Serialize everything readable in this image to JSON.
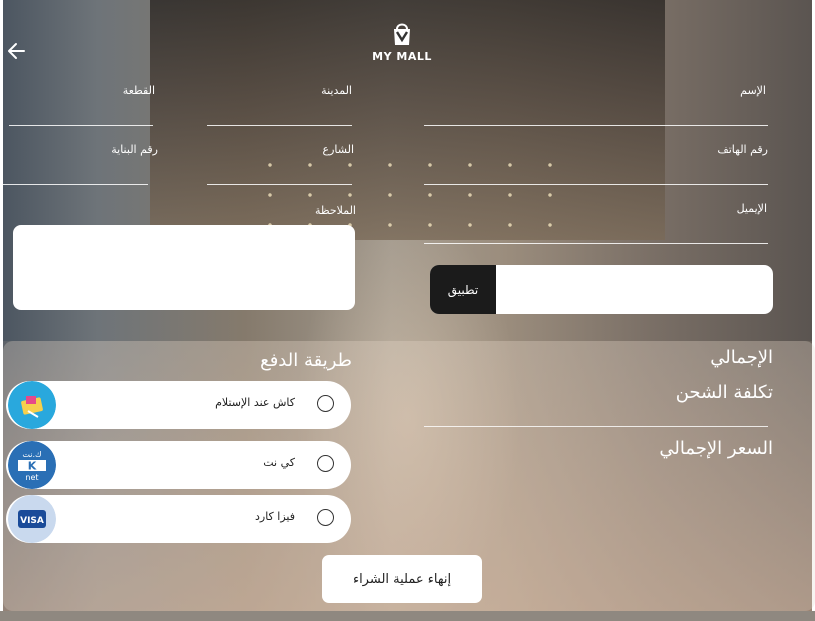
{
  "app": {
    "logo_text": "MY MALL"
  },
  "form": {
    "name_label": "الإسم",
    "city_label": "المدينة",
    "piece_label": "القطعة",
    "phone_label": "رقم الهاتف",
    "street_label": "الشارع",
    "building_label": "رقم البناية",
    "email_label": "الإيميل",
    "note_label": "الملاحظة",
    "note_value": "",
    "email_value": ""
  },
  "coupon": {
    "apply_label": "تطبيق",
    "value": ""
  },
  "payment": {
    "title": "طريقة الدفع",
    "options": [
      {
        "label": "كاش عند  الإستلام",
        "icon": "cash-icon"
      },
      {
        "label": "كي نت",
        "icon": "knet-icon"
      },
      {
        "label": "فيزا كارد",
        "icon": "visa-icon"
      }
    ]
  },
  "summary": {
    "total_label": "الإجمالي",
    "shipping_label": "تكلفة الشحن",
    "grand_total_label": "السعر الإجمالي"
  },
  "actions": {
    "finish_label": "إنهاء عملية الشراء"
  },
  "colors": {
    "dark_button": "#1b1b1b",
    "white": "#ffffff"
  }
}
